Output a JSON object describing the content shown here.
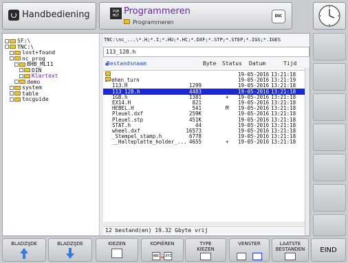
{
  "header": {
    "left_mode": "Handbediening",
    "right_mode_title": "Programmeren",
    "right_mode_sub": "Programmeren",
    "dnc_label": "DNC",
    "pgm_badge": "PGM MGT"
  },
  "filter": "TNC:\\nc_...\\*.H;*.I;*.HU;*.HC;*.DXF;*.STP;*.STEP;*.IGS;*.IGES",
  "filename_field": "113_128.h",
  "tree": [
    {
      "label": "SF:\\",
      "indent": 0,
      "expanded": false
    },
    {
      "label": "TNC:\\",
      "indent": 0,
      "expanded": true
    },
    {
      "label": "lost+found",
      "indent": 1,
      "expanded": false
    },
    {
      "label": "nc_prog",
      "indent": 1,
      "expanded": true
    },
    {
      "label": "BHB_ML11",
      "indent": 2,
      "expanded": true
    },
    {
      "label": "DIN",
      "indent": 3,
      "expanded": false
    },
    {
      "label": "Klartext",
      "indent": 3,
      "expanded": false,
      "active": true
    },
    {
      "label": "demo",
      "indent": 2,
      "expanded": false
    },
    {
      "label": "system",
      "indent": 1,
      "expanded": false
    },
    {
      "label": "table",
      "indent": 1,
      "expanded": false
    },
    {
      "label": "tncguide",
      "indent": 1,
      "expanded": false
    }
  ],
  "columns": {
    "name": "Bestandsnaam",
    "size": "Byte",
    "status": "Status",
    "date": "Datum",
    "time": "Tijd"
  },
  "files": [
    {
      "name": "..",
      "folder": true,
      "size": "",
      "status": "",
      "date": "19-05-2016",
      "time": "13:21:18"
    },
    {
      "name": "Drehen_turn",
      "folder": true,
      "size": "",
      "status": "",
      "date": "19-05-2016",
      "time": "13:21:19"
    },
    {
      "name": "113.H",
      "size": "1299",
      "status": "",
      "date": "19-05-2016",
      "time": "13:21:18"
    },
    {
      "name": "113_128.h",
      "size": "4483",
      "status": "",
      "date": "19-05-2016",
      "time": "13:21:18",
      "selected": true
    },
    {
      "name": "1GB.h",
      "size": "1381",
      "status": "+",
      "date": "19-05-2016",
      "time": "13:21:18"
    },
    {
      "name": "EX14.H",
      "size": "821",
      "status": "",
      "date": "19-05-2016",
      "time": "13:21:18"
    },
    {
      "name": "HEBEL.H",
      "size": "541",
      "status": "M",
      "date": "19-05-2016",
      "time": "13:21:18"
    },
    {
      "name": "Pleuel.dxf",
      "size": "259K",
      "status": "",
      "date": "19-05-2016",
      "time": "13:21:18"
    },
    {
      "name": "Pleuel.stp",
      "size": "451K",
      "status": "",
      "date": "19-05-2016",
      "time": "13:21:18"
    },
    {
      "name": "STAT.h",
      "size": "44",
      "status": "",
      "date": "19-05-2016",
      "time": "13:21:18"
    },
    {
      "name": "wheel.dxf",
      "size": "16573",
      "status": "",
      "date": "19-05-2016",
      "time": "13:21:18"
    },
    {
      "name": "_Stempel_stamp.h",
      "size": "6778",
      "status": "",
      "date": "19-05-2016",
      "time": "13:21:18"
    },
    {
      "name": "__Halteplatte_holder_...",
      "size": "4655",
      "status": "+",
      "date": "19-05-2016",
      "time": "13:21:18"
    }
  ],
  "status_bar": "12  bestand(en)  19.32 Gbyte vrij",
  "softkeys": [
    {
      "label": "BLADZIJDE",
      "icon": "arrow-up-icon"
    },
    {
      "label": "BLADZIJDE",
      "icon": "arrow-down-icon"
    },
    {
      "label": "KIEZEN",
      "icon": "select-file-icon"
    },
    {
      "label": "KOPIËREN",
      "icon": "copy-icon",
      "icon_text_a": "ABC",
      "icon_text_b": "XYZ"
    },
    {
      "label": "TYPE\nKIEZEN",
      "icon": "file-type-icon"
    },
    {
      "label": "VENSTER",
      "icon": "window-icon"
    },
    {
      "label": "LAATSTE\nBESTANDEN",
      "icon": "last-files-icon"
    },
    {
      "label": "EIND",
      "icon": ""
    }
  ],
  "colors": {
    "selection": "#1a28d8",
    "accent_purple": "#6a1fb0",
    "folder": "#e6c24a",
    "arrow": "#3a7ad8"
  }
}
